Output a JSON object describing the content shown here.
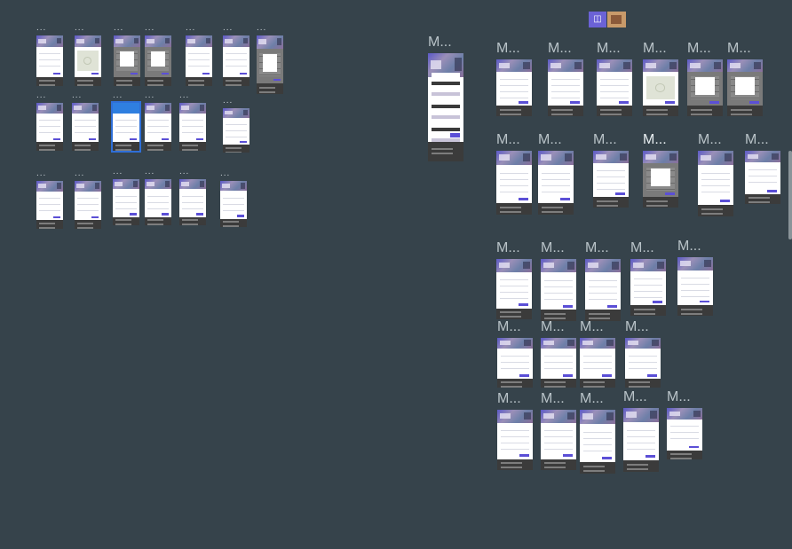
{
  "canvas": {
    "background": "#36434b",
    "accent": "#5b4fd6",
    "selection": "#2f6fd8"
  },
  "icons": {
    "logo": "brand-logo-icon",
    "logo_glyph": "◫"
  },
  "labels": {
    "dots": "...",
    "short": "M..."
  }
}
